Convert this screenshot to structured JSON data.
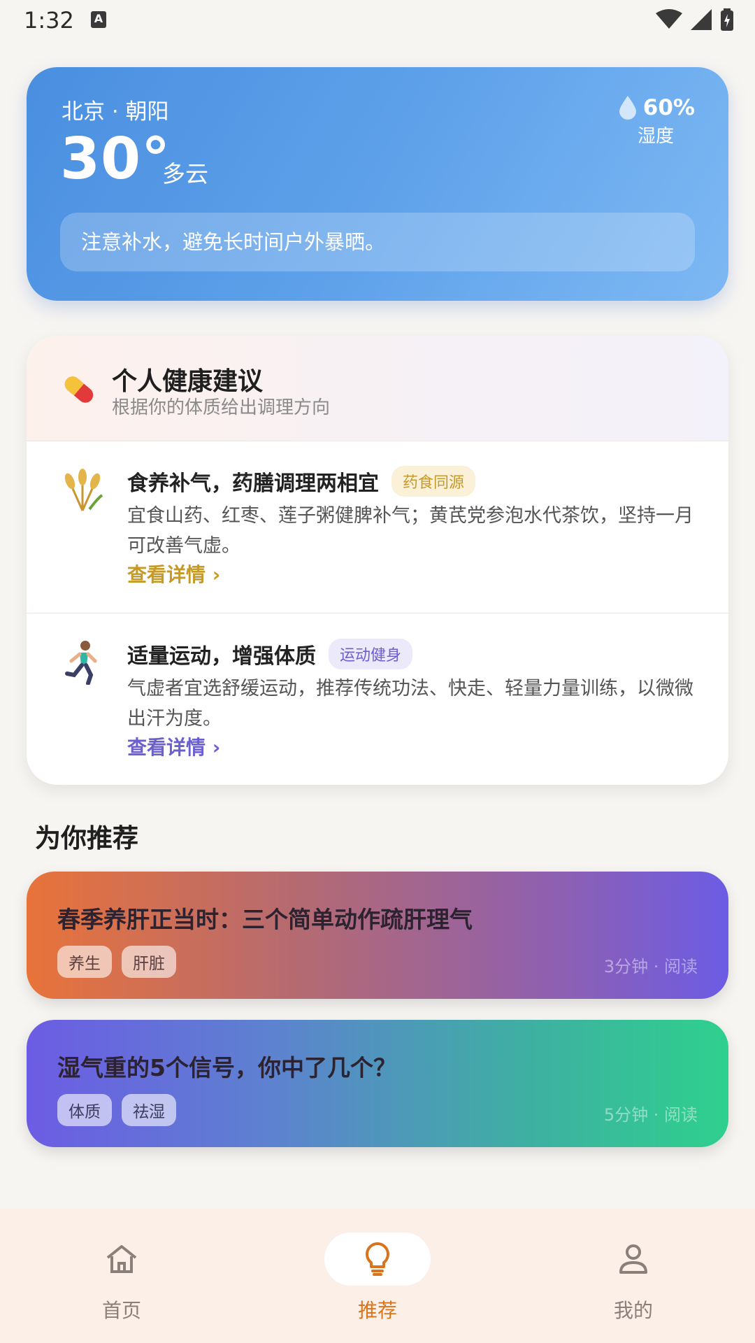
{
  "status_bar": {
    "time": "1:32",
    "keyboard_indicator": "A"
  },
  "weather": {
    "location": "北京 · 朝阳",
    "temperature": "30°",
    "condition": "多云",
    "humidity_value": "60%",
    "humidity_label": "湿度",
    "tip": "注意补水，避免长时间户外暴晒。"
  },
  "health": {
    "title": "个人健康建议",
    "subtitle": "根据你的体质给出调理方向",
    "items": [
      {
        "icon": "wheat-icon",
        "title": "食养补气，药膳调理两相宜",
        "tag": "药食同源",
        "text": "宜食山药、红枣、莲子粥健脾补气；黄芪党参泡水代茶饮，坚持一月可改善气虚。",
        "link": "查看详情 ›"
      },
      {
        "icon": "runner-icon",
        "title": "适量运动，增强体质",
        "tag": "运动健身",
        "text": "气虚者宜选舒缓运动，推荐传统功法、快走、轻量力量训练，以微微出汗为度。",
        "link": "查看详情 ›"
      }
    ]
  },
  "recommend": {
    "section_title": "为你推荐",
    "cards": [
      {
        "title": "春季养肝正当时：三个简单动作疏肝理气",
        "tags": [
          "养生",
          "肝脏"
        ],
        "meta": "3分钟 · 阅读"
      },
      {
        "title": "湿气重的5个信号，你中了几个？",
        "tags": [
          "体质",
          "祛湿"
        ],
        "meta": "5分钟 · 阅读"
      }
    ]
  },
  "bottom_nav": {
    "items": [
      {
        "label": "首页",
        "icon": "home-icon"
      },
      {
        "label": "推荐",
        "icon": "lightbulb-icon",
        "active": true
      },
      {
        "label": "我的",
        "icon": "person-icon"
      }
    ]
  },
  "colors": {
    "accent": "#d9741d",
    "weather_blue": "#4a8fe0",
    "link_yellow": "#c59a27",
    "link_purple": "#6b5fd0"
  }
}
